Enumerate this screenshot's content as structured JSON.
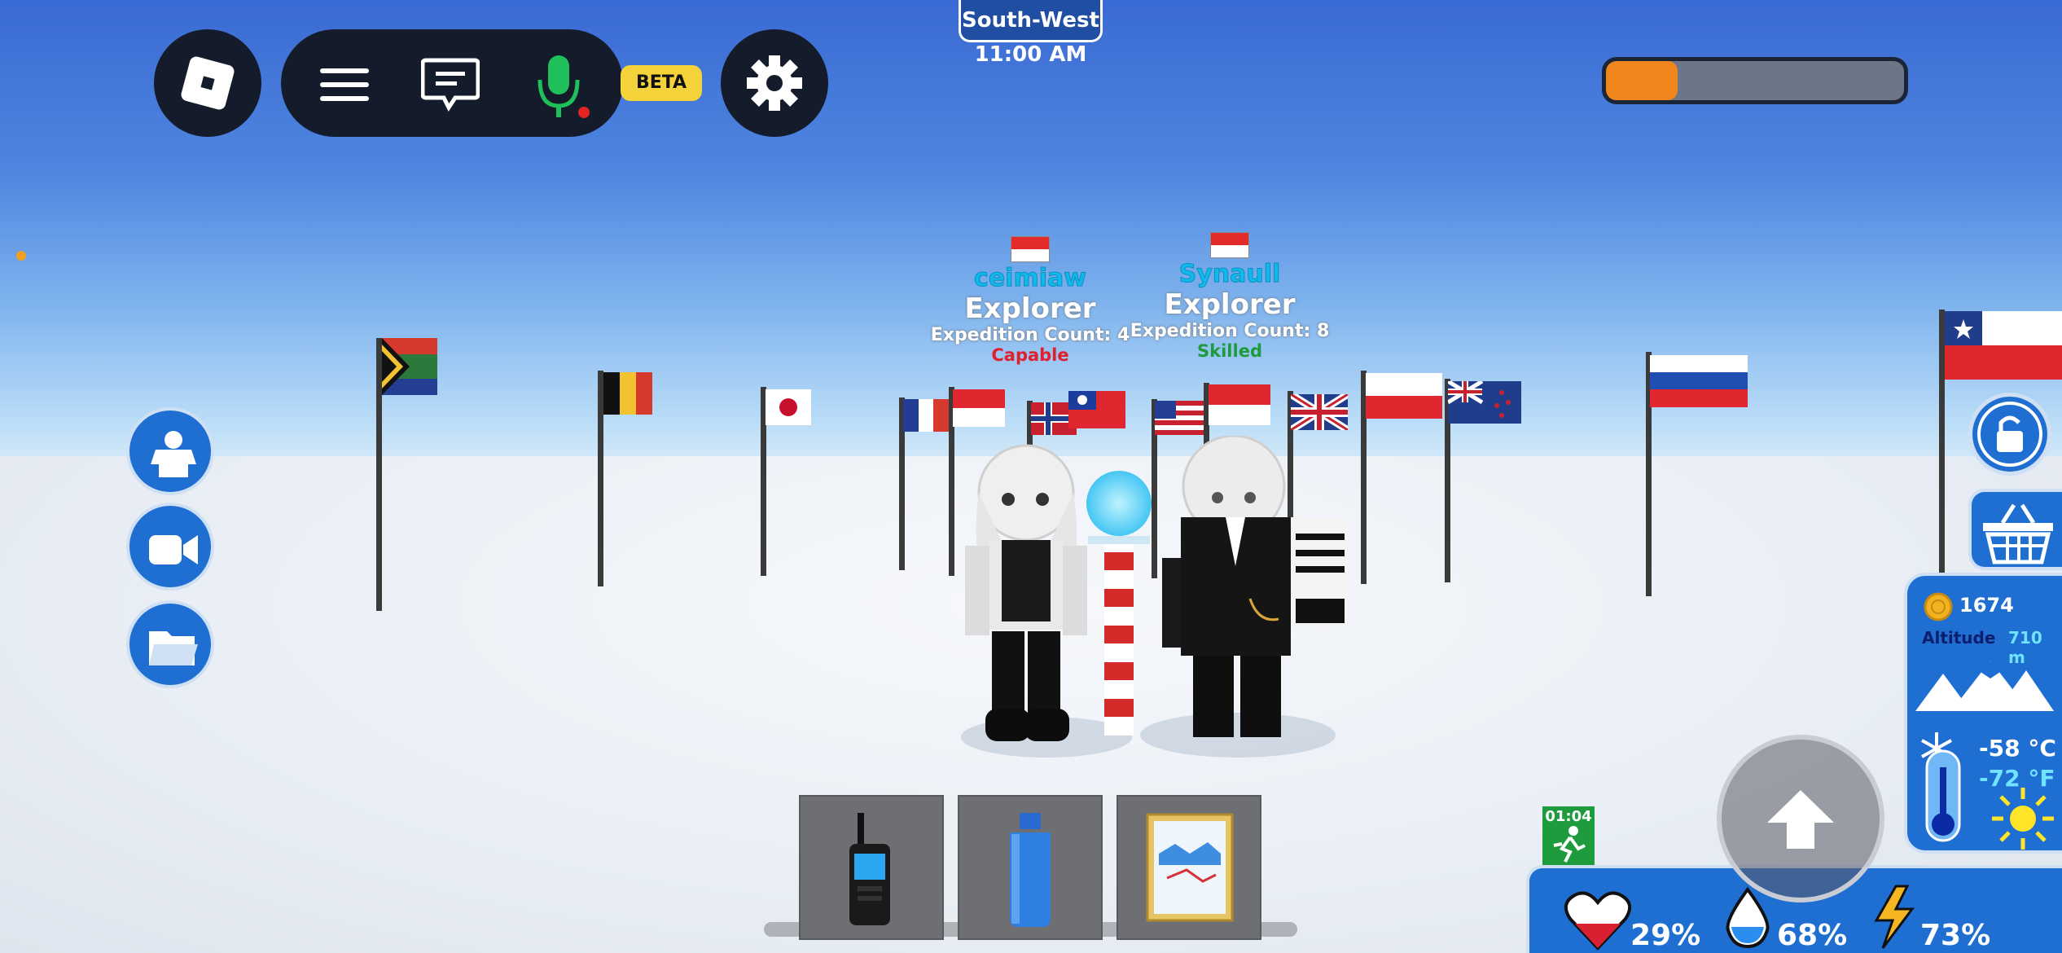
{
  "hud": {
    "beta_label": "BETA",
    "direction": "South-West",
    "time": "11:00 AM",
    "progress_fraction": 0.24
  },
  "players": [
    {
      "name": "ceimiaw",
      "rank": "Explorer",
      "expedition": "Expedition Count: 4",
      "skill": "Capable",
      "skill_color": "#e0202a"
    },
    {
      "name": "Synaull",
      "rank": "Explorer",
      "expedition": "Expedition Count: 8",
      "skill": "Skilled",
      "skill_color": "#1e9b3d"
    }
  ],
  "stats": {
    "coins": "1674",
    "altitude_label": "Altitude",
    "altitude_value": "710 m",
    "temp_c": "-58 °C",
    "temp_f": "-72 °F"
  },
  "timer": "01:04",
  "vitals": {
    "health": "29%",
    "water": "68%",
    "energy": "73%"
  },
  "hotbar": [
    {
      "icon": "radio-icon"
    },
    {
      "icon": "water-bottle-icon"
    },
    {
      "icon": "map-icon"
    }
  ],
  "colors": {
    "accent_blue": "#1f6fd3",
    "progress": "#f0861c",
    "dark": "#141b2a"
  }
}
